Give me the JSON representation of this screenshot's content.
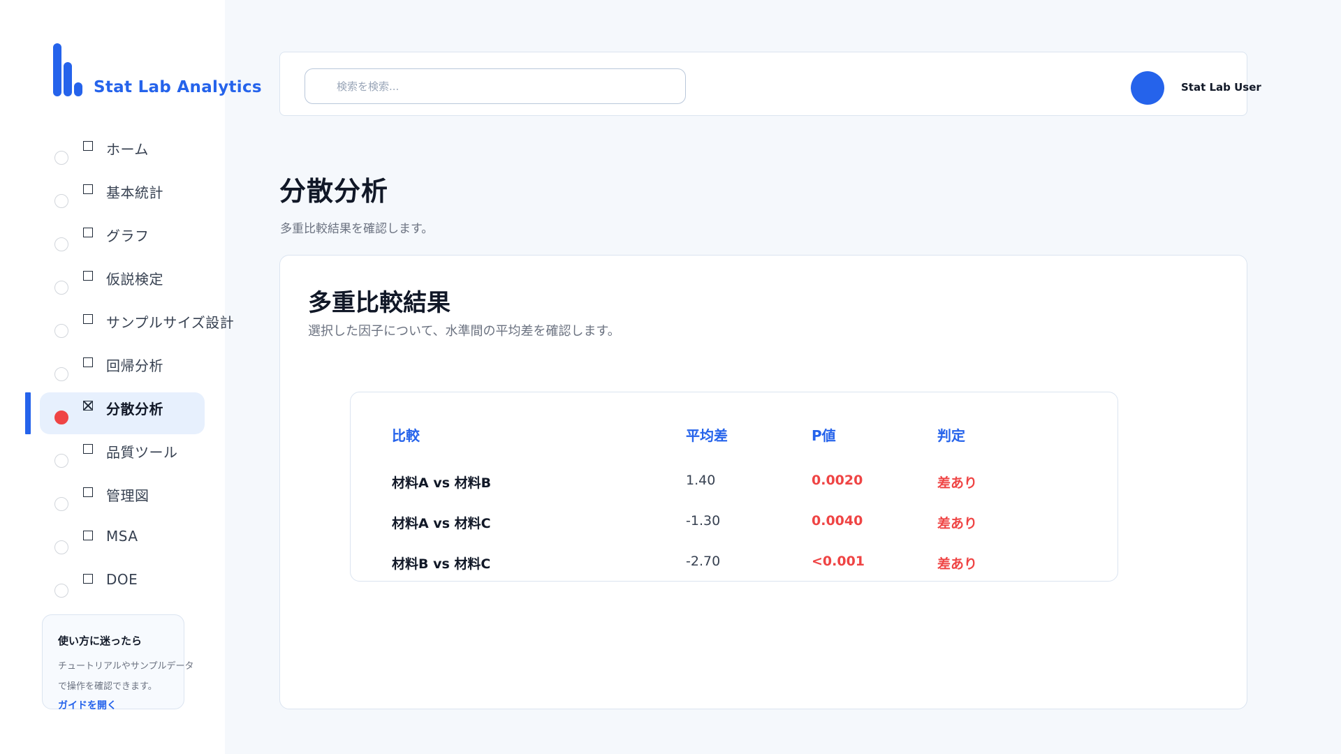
{
  "app": {
    "name": "Stat Lab Analytics"
  },
  "sidebar": {
    "items": [
      {
        "label": "ホーム"
      },
      {
        "label": "基本統計"
      },
      {
        "label": "グラフ"
      },
      {
        "label": "仮説検定"
      },
      {
        "label": "サンプルサイズ設計"
      },
      {
        "label": "回帰分析"
      },
      {
        "label": "分散分析",
        "active": true
      },
      {
        "label": "品質ツール"
      },
      {
        "label": "管理図"
      },
      {
        "label": "MSA"
      },
      {
        "label": "DOE"
      }
    ],
    "help": {
      "title": "使い方に迷ったら",
      "description": "チュートリアルやサンプルデータで操作を確認できます。",
      "link": "ガイドを開く"
    }
  },
  "header": {
    "search_placeholder": "検索を検索...",
    "user_name": "Stat Lab User"
  },
  "page": {
    "title": "分散分析",
    "subtitle": "多重比較結果を確認します。"
  },
  "card": {
    "title": "多重比較結果",
    "description": "選択した因子について、水準間の平均差を確認します。",
    "table": {
      "headers": {
        "comparison": "比較",
        "mean_diff": "平均差",
        "p_value": "P値",
        "judgement": "判定"
      },
      "rows": [
        {
          "comparison": "材料A vs 材料B",
          "mean_diff": "1.40",
          "p_value": "0.0020",
          "judgement": "差あり"
        },
        {
          "comparison": "材料A vs 材料C",
          "mean_diff": "-1.30",
          "p_value": "0.0040",
          "judgement": "差あり"
        },
        {
          "comparison": "材料B vs 材料C",
          "mean_diff": "-2.70",
          "p_value": "<0.001",
          "judgement": "差あり"
        }
      ]
    }
  },
  "colors": {
    "accent": "#2563eb",
    "danger": "#ef4444",
    "active_bg": "#e7f0fd"
  }
}
